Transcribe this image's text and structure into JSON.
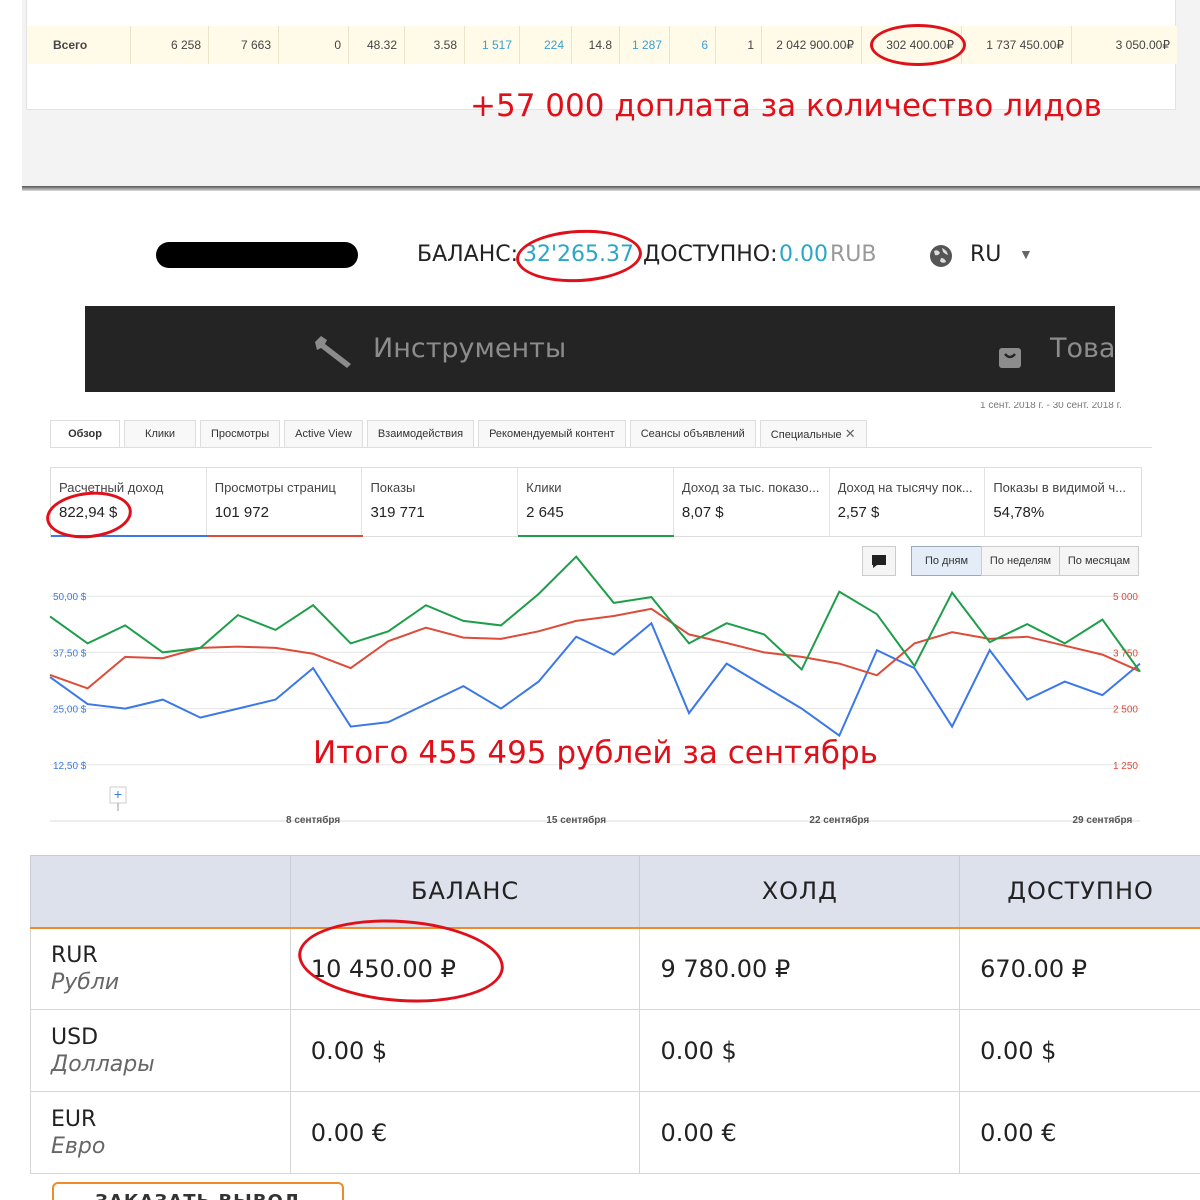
{
  "totals": {
    "label": "Всего",
    "cells": [
      "6 258",
      "7 663",
      "0",
      "48.32",
      "3.58",
      "1 517",
      "224",
      "14.8",
      "1 287",
      "6",
      "1",
      "2 042 900.00₽",
      "302 400.00₽",
      "1 737 450.00₽",
      "3 050.00₽"
    ]
  },
  "annotations": {
    "bonus": "+57 000 доплата за количество лидов",
    "total": "Итого 455 495 рублей за сентябрь"
  },
  "account": {
    "balance_label": "БАЛАНС:",
    "balance_value": "32'265.37",
    "available_label": "ДОСТУПНО:",
    "available_value": "0.00",
    "available_currency": "RUB",
    "language": "RU"
  },
  "nav": {
    "tools": "Инструменты",
    "goods": "Товар"
  },
  "adsense": {
    "tabs": [
      "Обзор",
      "Клики",
      "Просмотры",
      "Active View",
      "Взаимодействия",
      "Рекомендуемый контент",
      "Сеансы объявлений",
      "Специальные"
    ],
    "date_range": "1 сент. 2018 г. - 30 сент. 2018 г.",
    "metrics": [
      {
        "label": "Расчетный доход",
        "value": "822,94 $",
        "color": "#3b78e7"
      },
      {
        "label": "Просмотры страниц",
        "value": "101 972",
        "color": "#dd4b39"
      },
      {
        "label": "Показы",
        "value": "319 771",
        "color": ""
      },
      {
        "label": "Клики",
        "value": "2 645",
        "color": "#1e9e4a"
      },
      {
        "label": "Доход за тыс. показо...",
        "value": "8,07 $",
        "color": ""
      },
      {
        "label": "Доход на тысячу пок...",
        "value": "2,57 $",
        "color": ""
      },
      {
        "label": "Показы в видимой ч...",
        "value": "54,78%",
        "color": ""
      }
    ],
    "granularity": [
      "По дням",
      "По неделям",
      "По месяцам"
    ]
  },
  "chart_data": {
    "type": "line",
    "x": [
      "1",
      "2",
      "3",
      "4",
      "5",
      "6",
      "7",
      "8",
      "9",
      "10",
      "11",
      "12",
      "13",
      "14",
      "15",
      "16",
      "17",
      "18",
      "19",
      "20",
      "21",
      "22",
      "23",
      "24",
      "25",
      "26",
      "27",
      "28",
      "29",
      "30"
    ],
    "x_tick_labels": [
      "8 сентября",
      "15 сентября",
      "22 сентября",
      "29 сентября"
    ],
    "left_axis_ticks": [
      "12,50 $",
      "25,00 $",
      "37,50 $",
      "50,00 $"
    ],
    "right_axis_ticks": [
      "1 250",
      "2 500",
      "3 750",
      "5 000"
    ],
    "left_ylim": [
      0,
      62.5
    ],
    "right_ylim": [
      0,
      6250
    ],
    "series": [
      {
        "name": "Расчетный доход",
        "color": "#3b78e7",
        "axis": "left",
        "values": [
          32,
          26,
          25,
          27,
          23,
          25,
          27,
          34,
          21,
          22,
          26,
          30,
          25,
          31,
          41,
          37,
          44,
          24,
          35,
          30,
          25,
          19,
          38,
          34,
          21,
          38,
          27,
          31,
          28,
          35
        ]
      },
      {
        "name": "Просмотры страниц",
        "color": "#dd4b39",
        "axis": "right",
        "values": [
          3250,
          2950,
          3650,
          3620,
          3850,
          3880,
          3850,
          3720,
          3400,
          4000,
          4300,
          4080,
          4050,
          4220,
          4450,
          4560,
          4720,
          4150,
          3960,
          3750,
          3650,
          3500,
          3240,
          3950,
          4200,
          4050,
          4100,
          3900,
          3700,
          3330
        ]
      },
      {
        "name": "Клики",
        "color": "#1e9e4a",
        "axis": "right",
        "values": [
          4550,
          3950,
          4350,
          3750,
          3850,
          4580,
          4250,
          4800,
          3950,
          4220,
          4800,
          4450,
          4350,
          5050,
          5880,
          4850,
          4980,
          3950,
          4400,
          4150,
          3370,
          5100,
          4600,
          3450,
          5080,
          3980,
          4380,
          3950,
          4480,
          3320
        ]
      }
    ]
  },
  "balances": {
    "headers": [
      "",
      "БАЛАНС",
      "ХОЛД",
      "ДОСТУПНО"
    ],
    "rows": [
      {
        "code": "RUR",
        "name": "Рубли",
        "balance": "10 450.00 ₽",
        "hold": "9 780.00 ₽",
        "available": "670.00 ₽"
      },
      {
        "code": "USD",
        "name": "Доллары",
        "balance": "0.00 $",
        "hold": "0.00 $",
        "available": "0.00 $"
      },
      {
        "code": "EUR",
        "name": "Евро",
        "balance": "0.00 €",
        "hold": "0.00 €",
        "available": "0.00 €"
      }
    ],
    "withdraw_label": "ЗАКАЗАТЬ ВЫВОД"
  },
  "colors": {
    "annotation": "#e0101a",
    "link": "#3a9fd6",
    "orange": "#f08b2c"
  }
}
